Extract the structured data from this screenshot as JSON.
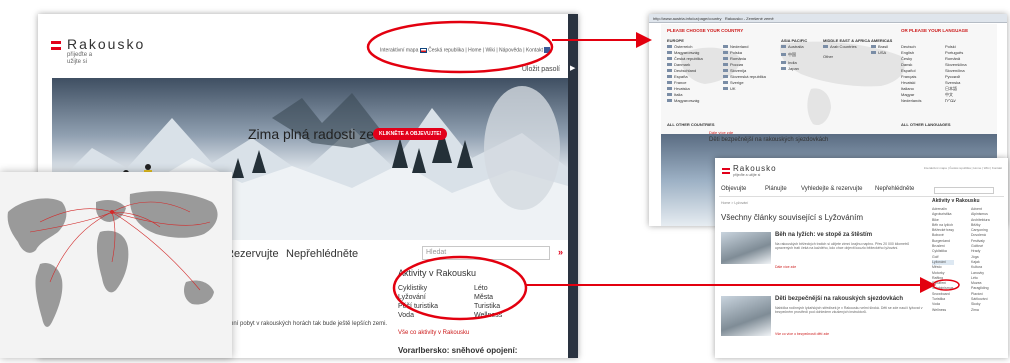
{
  "main": {
    "logo_title": "Rakousko",
    "logo_sub": "přijeďte a užijte si",
    "utility": [
      "Interaktivní mapa",
      "Česká republika",
      "Home",
      "Wiki",
      "Nápověda",
      "Kontakt"
    ],
    "forgot": "Uložit pasolí",
    "hero_caption": "Zima plná radosti ze života",
    "hero_cta": "KLIKNĚTE A OBJEVUJTE!",
    "nav": [
      "Rezervujte",
      "Nepřehlédněte"
    ],
    "search_placeholder": "Hledat",
    "activities_title": "Aktivity v Rakousku",
    "activities_col1": [
      "Cyklistiky",
      "Lyžování",
      "Pěší turistika",
      "Voda"
    ],
    "activities_col2": [
      "Léto",
      "Města",
      "Turistika",
      "Wellness"
    ],
    "activities_more": "Vše co aktivity v Rakousku",
    "body_text": "zimní pobyt v rakouských horách tak bude ještě lepších zemi.",
    "vorarl": "Vorarlbersko: sněhové opojení:"
  },
  "country": {
    "browser_url": "http://www.austria.info/cz/page/country",
    "browser_tab": "Rakousko - Zemšené země",
    "title_left": "PLEASE CHOOSE YOUR COUNTRY",
    "title_right": "OR PLEASE YOUR LANGUAGE",
    "col_heads": [
      "EUROPE",
      "ASIA PACIFIC",
      "MIDDLE EAST & AFRICA",
      "AMERICAS"
    ],
    "europe_a": [
      "Österreich",
      "Magyarország",
      "Česká republika",
      "Danmark",
      "Deutschland",
      "España",
      "France",
      "Hrvatska",
      "Italia",
      "Magyarország"
    ],
    "europe_b": [
      "Nederland",
      "Polska",
      "România",
      "Россия",
      "Slovenija",
      "Slovenská republika",
      "Sverige",
      "UK"
    ],
    "asia": [
      "Australia",
      "中国",
      "India",
      "Japan"
    ],
    "mea": [
      "Arab Countries",
      "Other"
    ],
    "americas": [
      "Brasil",
      "USA"
    ],
    "languages_a": [
      "Deutsch",
      "English",
      "Česky",
      "Dansk",
      "Español",
      "Français",
      "Hrvatski",
      "Italiano",
      "Magyar",
      "Nederlands"
    ],
    "languages_b": [
      "Polski",
      "Português",
      "Română",
      "Slovenščina",
      "Slovenčina",
      "Русский",
      "Svenska",
      "日本語",
      "中文",
      "עברית"
    ],
    "all_other": "ALL OTHER COUNTRIES",
    "all_langs": "ALL OTHER LANGUAGES",
    "caption": "Děti bezpečnější na rakouských sjezdovkách",
    "redlink": "Dále více zde"
  },
  "ski": {
    "logo_title": "Rakousko",
    "logo_sub": "přijeďte a užijte si",
    "topright": "Interaktivní mapa | Česká republika | Home | Wiki | Kontakt",
    "nav": [
      "Objevujte",
      "Plánujte",
      "Vyhledejte & rezervujte",
      "Nepřehlédněte"
    ],
    "crumb": "Home > Lyžování",
    "page_title": "Všechny články související s Lyžováním",
    "art1_head": "Běh na lyžích: ve stopě za štěstím",
    "art1_text": "Na rakouských běžeckých tratích si užijete zimní krajinu naplno. Přes 20 000 kilometrů upravených tratí čeká na každého, kdo chce objevit kouzlo běžeckého lyžování.",
    "art1_more": "Dále více zde",
    "art2_head": "Děti bezpečnější na rakouských sjezdovkách",
    "art2_text": "Nabídka rodinných lyžařských středisek je v Rakousku velmi široká. Děti se zde naučí lyžovat v bezpečném prostředí pod dohledem zkušených instruktorů.",
    "art2_more": "Vše co více o bezpečnosti dětí zde",
    "side_head": "Aktivity v Rakousku",
    "side_col1": [
      "Adrenalin",
      "Agroturistika",
      "Bike",
      "Běh na lyžích",
      "Běžecké trasy",
      "Bobové",
      "Burgenland",
      "Bruslení",
      "Cyklistika",
      "Golf",
      "Lyžování",
      "Město",
      "Motorky",
      "Rafting",
      "Rybaření",
      "Skialpinismus",
      "Snowboard",
      "Turistika",
      "Voda",
      "Wellness"
    ],
    "side_col2": [
      "Advent",
      "Alpinismus",
      "Architektura",
      "Běžky",
      "Canyoning",
      "Dovolená",
      "Festivaly",
      "Golfové",
      "Hrady",
      "Jóga",
      "Kajak",
      "Kultura",
      "Lanovky",
      "Léto",
      "Muzea",
      "Paragliding",
      "Plavání",
      "Sáňkování",
      "Skoky",
      "Zima"
    ]
  },
  "colors": {
    "brand_red": "#e2001a",
    "link_red": "#cc1a1a",
    "annotation_red": "#e3000f"
  }
}
